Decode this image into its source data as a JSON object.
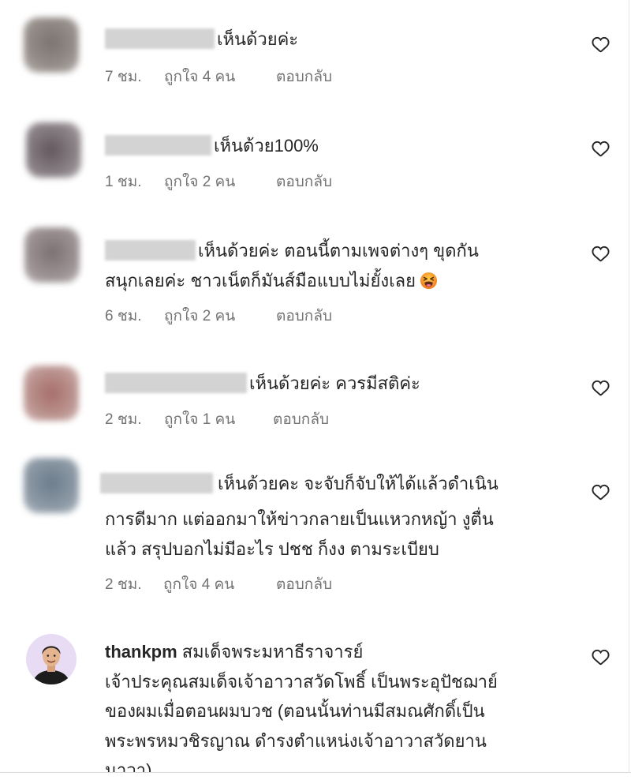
{
  "theme": {
    "text": "#262626",
    "secondary": "#737373",
    "divider": "#dbdbdb",
    "background": "#ffffff"
  },
  "icons": {
    "like": "heart-outline-icon",
    "avatar_placeholder": "blurred-avatar"
  },
  "comments": [
    {
      "lines": [
        "เห็นด้วยค่ะ"
      ],
      "time": "7 ชม.",
      "likes": "ถูกใจ 4 คน",
      "reply": "ตอบกลับ"
    },
    {
      "lines": [
        "เห็นด้วย100%"
      ],
      "time": "1 ชม.",
      "likes": "ถูกใจ 2 คน",
      "reply": "ตอบกลับ"
    },
    {
      "lines": [
        "เห็นด้วยค่ะ ตอนนี้ตามเพจต่างๆ ขุดกัน",
        "สนุกเลยค่ะ ชาวเน็ตก็มันส์มือแบบไม่ยั้งเลย"
      ],
      "emoji": "tired-face-emoji",
      "time": "6 ชม.",
      "likes": "ถูกใจ 2 คน",
      "reply": "ตอบกลับ"
    },
    {
      "lines": [
        "เห็นด้วยค่ะ ควรมีสติค่ะ"
      ],
      "time": "2 ชม.",
      "likes": "ถูกใจ 1 คน",
      "reply": "ตอบกลับ"
    },
    {
      "lines": [
        "เห็นด้วยคะ จะจับก็จับให้ได้แล้วดำเนิน",
        "การดีมาก แต่ออกมาให้ข่าวกลายเป็นแหวกหญ้า งูตื่น",
        "แล้ว สรุปบอกไม่มีอะไร ปชช ก็งง ตามระเบียบ"
      ],
      "time": "2 ชม.",
      "likes": "ถูกใจ 4 คน",
      "reply": "ตอบกลับ"
    },
    {
      "username": "thankpm",
      "lines": [
        "สมเด็จพระมหาธีราจารย์",
        "เจ้าประคุณสมเด็จเจ้าอาวาสวัดโพธิ์ เป็นพระอุปัชฌาย์",
        "ของผมเมื่อตอนผมบวช (ตอนนั้นท่านมีสมณศักดิ์เป็น",
        "พระพรหมวชิรญาณ ดำรงตำแหน่งเจ้าอาวาสวัดยาน",
        "นาวา)"
      ]
    }
  ]
}
